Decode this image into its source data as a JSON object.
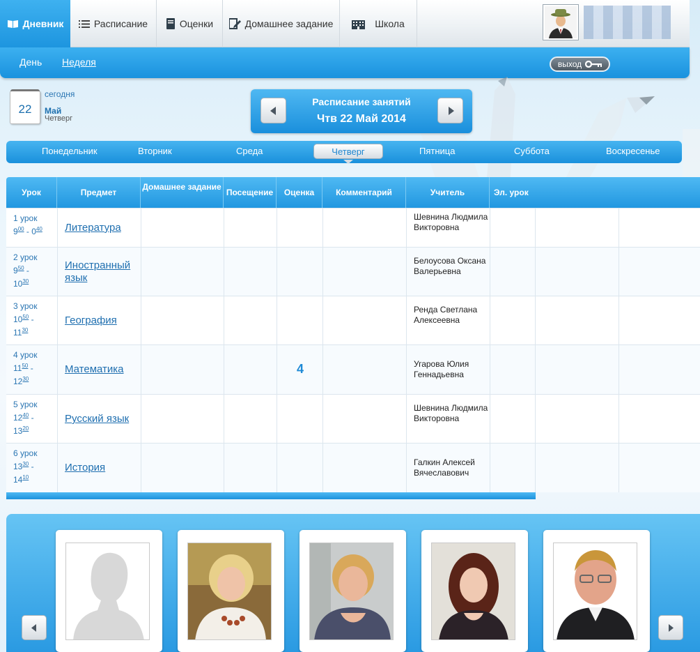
{
  "nav": {
    "tabs": [
      {
        "label": "Дневник",
        "icon": "book-icon"
      },
      {
        "label": "Расписание",
        "icon": "list-icon"
      },
      {
        "label": "Оценки",
        "icon": "notebook-icon"
      },
      {
        "label": "Домашнее задание",
        "icon": "pen-icon"
      },
      {
        "label": "Школа",
        "icon": "building-icon"
      }
    ]
  },
  "subnav": {
    "day": "День",
    "week": "Неделя",
    "exit": "выход"
  },
  "calendar": {
    "today_label": "сегодня",
    "day_number": "22",
    "month": "Май",
    "weekday": "Четверг"
  },
  "schedule": {
    "title": "Расписание занятий",
    "date": "Чтв 22 Май 2014"
  },
  "days": [
    "Понедельник",
    "Вторник",
    "Среда",
    "Четверг",
    "Пятница",
    "Суббота",
    "Воскресенье"
  ],
  "table": {
    "headers": [
      "Урок",
      "Предмет",
      "Домашнее задание",
      "Посещение",
      "Оценка",
      "Комментарий",
      "Учитель",
      "Эл. урок"
    ],
    "rows": [
      {
        "lesson": "1 урок",
        "start_h": "9",
        "start_m": "00",
        "end_h": "0",
        "end_m": "40",
        "subject": "Литература",
        "grade": "",
        "teacher": "Шевнина Людмила Викторовна"
      },
      {
        "lesson": "2 урок",
        "start_h": "9",
        "start_m": "50",
        "end_h": "10",
        "end_m": "30",
        "subject": "Иностранный язык",
        "grade": "",
        "teacher": "Белоусова Оксана Валерьевна"
      },
      {
        "lesson": "3 урок",
        "start_h": "10",
        "start_m": "50",
        "end_h": "11",
        "end_m": "30",
        "subject": "География",
        "grade": "",
        "teacher": "Ренда Светлана Алексеевна"
      },
      {
        "lesson": "4 урок",
        "start_h": "11",
        "start_m": "50",
        "end_h": "12",
        "end_m": "30",
        "subject": "Математика",
        "grade": "4",
        "teacher": "Угарова Юлия Геннадьевна"
      },
      {
        "lesson": "5 урок",
        "start_h": "12",
        "start_m": "40",
        "end_h": "13",
        "end_m": "20",
        "subject": "Русский язык",
        "grade": "",
        "teacher": "Шевнина Людмила Викторовна"
      },
      {
        "lesson": "6 урок",
        "start_h": "13",
        "start_m": "30",
        "end_h": "14",
        "end_m": "10",
        "subject": "История",
        "grade": "",
        "teacher": "Галкин Алексей Вячеславович"
      }
    ]
  },
  "colors": {
    "accent": "#1d95df",
    "link": "#1f6fb0",
    "grade": "#1f8ad6"
  }
}
